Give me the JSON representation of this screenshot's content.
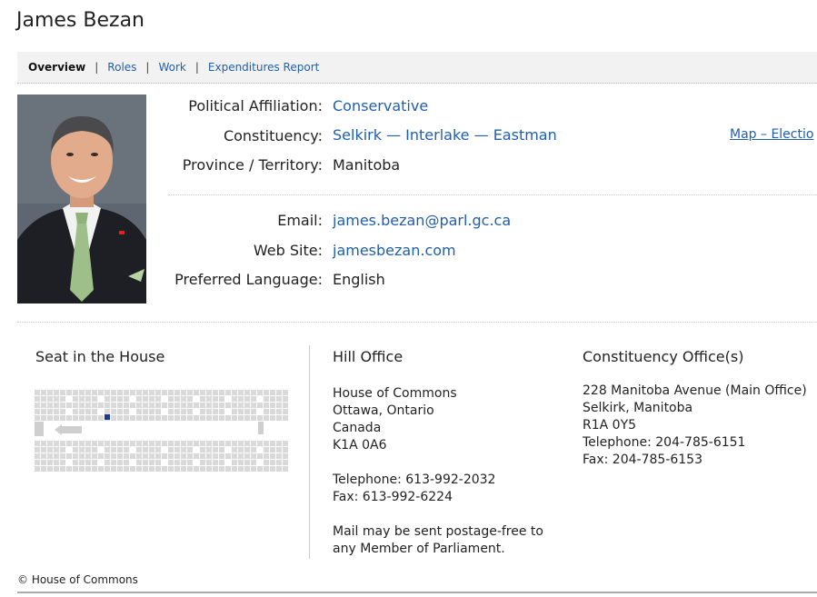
{
  "page_title": "James Bezan",
  "tabs": [
    {
      "label": "Overview",
      "active": true
    },
    {
      "label": "Roles"
    },
    {
      "label": "Work"
    },
    {
      "label": "Expenditures Report"
    }
  ],
  "tab_separator": "|",
  "profile": {
    "political_affiliation": {
      "label": "Political Affiliation:",
      "value": "Conservative"
    },
    "constituency": {
      "label": "Constituency:",
      "value": "Selkirk — Interlake — Eastman"
    },
    "province": {
      "label": "Province / Territory:",
      "value": "Manitoba"
    },
    "email": {
      "label": "Email:",
      "value": "james.bezan@parl.gc.ca"
    },
    "website": {
      "label": "Web Site:",
      "value": "jamesbezan.com"
    },
    "language": {
      "label": "Preferred Language:",
      "value": "English"
    },
    "map_link": "Map – Electio"
  },
  "seat": {
    "title": "Seat in the House"
  },
  "hill_office": {
    "title": "Hill Office",
    "lines": [
      "House of Commons",
      "Ottawa, Ontario",
      "Canada",
      "K1A 0A6"
    ],
    "telephone": "Telephone: 613-992-2032",
    "fax": "Fax: 613-992-6224",
    "note_line1": "Mail may be sent postage-free to",
    "note_line2": "any Member of Parliament."
  },
  "constituency_office": {
    "title": "Constituency Office(s)",
    "lines": [
      "228 Manitoba Avenue (Main Office)",
      "Selkirk, Manitoba",
      "R1A 0Y5",
      "Telephone: 204-785-6151",
      "Fax: 204-785-6153"
    ]
  },
  "footer": "© House of Commons",
  "colors": {
    "link": "#1f5fad",
    "seat_highlight": "#1a3a8c",
    "seat": "#d9d9d9"
  }
}
